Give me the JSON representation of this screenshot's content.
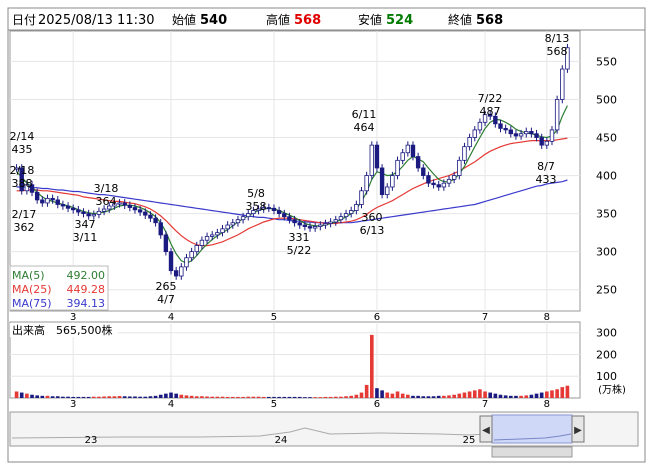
{
  "header": {
    "date_label": "日付",
    "datetime": "2025/08/13 11:30",
    "open_label": "始値",
    "open_value": "540",
    "high_label": "高値",
    "high_value": "568",
    "low_label": "安値",
    "low_value": "524",
    "close_label": "終値",
    "close_value": "568"
  },
  "colors": {
    "up": "#ffffff",
    "down": "#1a1a80",
    "ma5": "#2e7d32",
    "ma25": "#e53935",
    "ma75": "#3a3acc",
    "volume": "#1a1a80",
    "volume_spike": "#e53935",
    "high_value_color": "#e00000",
    "low_value_color": "#007a00"
  },
  "legend": {
    "ma5_label": "MA(5)",
    "ma5_value": "492.00",
    "ma25_label": "MA(25)",
    "ma25_value": "449.28",
    "ma75_label": "MA(75)",
    "ma75_value": "394.13"
  },
  "volume_panel": {
    "label": "出来高",
    "value": "565,500株",
    "unit": "(万株)",
    "ticks": [
      "300",
      "200",
      "100"
    ]
  },
  "navigator": {
    "labels": [
      "23",
      "24",
      "25"
    ]
  },
  "chart_data": {
    "type": "candlestick",
    "y_ticks": [
      "550",
      "500",
      "450",
      "400",
      "350",
      "300",
      "250"
    ],
    "ylim": [
      222,
      590
    ],
    "x_ticks": [
      "3",
      "4",
      "5",
      "6",
      "7",
      "8"
    ],
    "annotations": [
      {
        "date": "2/14",
        "value": "435"
      },
      {
        "date": "2/18",
        "value": "388"
      },
      {
        "date": "2/17",
        "value": "362"
      },
      {
        "date": "3/18",
        "value": "364"
      },
      {
        "date": "3/11",
        "value": "347"
      },
      {
        "date": "4/7",
        "value": "265"
      },
      {
        "date": "5/8",
        "value": "358"
      },
      {
        "date": "5/22",
        "value": "331"
      },
      {
        "date": "6/11",
        "value": "464"
      },
      {
        "date": "6/13",
        "value": "360"
      },
      {
        "date": "7/22",
        "value": "487"
      },
      {
        "date": "8/7",
        "value": "433"
      },
      {
        "date": "8/13",
        "value": "568"
      }
    ],
    "price_closes": [
      410,
      380,
      388,
      378,
      368,
      364,
      370,
      368,
      362,
      360,
      357,
      355,
      352,
      350,
      347,
      349,
      353,
      356,
      360,
      363,
      364,
      361,
      358,
      355,
      352,
      348,
      344,
      338,
      322,
      300,
      275,
      268,
      280,
      292,
      300,
      308,
      315,
      320,
      322,
      325,
      330,
      335,
      338,
      342,
      346,
      350,
      354,
      356,
      358,
      357,
      354,
      350,
      346,
      342,
      338,
      335,
      333,
      331,
      333,
      335,
      337,
      339,
      342,
      346,
      350,
      354,
      362,
      380,
      400,
      440,
      410,
      375,
      385,
      400,
      420,
      430,
      440,
      425,
      410,
      400,
      390,
      388,
      385,
      390,
      395,
      400,
      420,
      438,
      450,
      460,
      470,
      480,
      478,
      468,
      462,
      460,
      455,
      452,
      455,
      458,
      455,
      450,
      440,
      445,
      460,
      500,
      540,
      568
    ],
    "ma5": [
      405,
      398,
      390,
      385,
      378,
      372,
      368,
      366,
      364,
      362,
      360,
      358,
      355,
      353,
      351,
      350,
      351,
      352,
      354,
      357,
      360,
      361,
      361,
      360,
      358,
      355,
      351,
      346,
      338,
      326,
      310,
      297,
      288,
      285,
      288,
      295,
      303,
      310,
      316,
      321,
      325,
      329,
      334,
      339,
      343,
      347,
      351,
      354,
      356,
      357,
      356,
      354,
      351,
      348,
      345,
      341,
      337,
      335,
      334,
      334,
      335,
      337,
      339,
      342,
      346,
      350,
      356,
      366,
      378,
      395,
      405,
      403,
      400,
      401,
      405,
      412,
      420,
      425,
      422,
      418,
      410,
      402,
      395,
      392,
      392,
      395,
      402,
      412,
      425,
      438,
      450,
      462,
      470,
      474,
      473,
      470,
      466,
      461,
      458,
      456,
      455,
      453,
      451,
      450,
      452,
      460,
      478,
      492
    ],
    "ma25": [
      380,
      380,
      381,
      381,
      381,
      380,
      380,
      379,
      378,
      377,
      376,
      375,
      374,
      372,
      371,
      370,
      369,
      368,
      367,
      366,
      366,
      365,
      364,
      363,
      361,
      359,
      356,
      352,
      347,
      341,
      334,
      327,
      321,
      316,
      312,
      309,
      308,
      308,
      309,
      311,
      313,
      316,
      319,
      322,
      326,
      330,
      333,
      336,
      339,
      341,
      343,
      344,
      344,
      344,
      343,
      342,
      341,
      340,
      339,
      338,
      337,
      337,
      337,
      338,
      339,
      340,
      342,
      345,
      349,
      354,
      358,
      361,
      364,
      367,
      371,
      375,
      379,
      383,
      386,
      389,
      392,
      394,
      396,
      398,
      400,
      403,
      406,
      410,
      414,
      418,
      423,
      428,
      432,
      435,
      438,
      440,
      442,
      443,
      444,
      445,
      446,
      446,
      446,
      446,
      446,
      447,
      448,
      449.28
    ],
    "ma75": [
      385,
      385,
      385,
      384,
      384,
      383,
      383,
      382,
      381,
      381,
      380,
      379,
      379,
      378,
      377,
      376,
      375,
      375,
      374,
      373,
      372,
      371,
      370,
      369,
      368,
      367,
      366,
      365,
      364,
      363,
      362,
      361,
      360,
      359,
      358,
      357,
      356,
      355,
      354,
      353,
      352,
      351,
      350,
      349,
      348,
      347,
      346,
      345,
      345,
      344,
      343,
      342,
      342,
      341,
      340,
      340,
      339,
      339,
      338,
      338,
      338,
      338,
      338,
      338,
      338,
      338,
      339,
      340,
      341,
      342,
      343,
      344,
      345,
      346,
      347,
      348,
      349,
      350,
      351,
      352,
      353,
      354,
      355,
      356,
      357,
      358,
      359,
      360,
      361,
      362,
      364,
      366,
      368,
      370,
      372,
      374,
      376,
      378,
      380,
      382,
      384,
      386,
      387,
      389,
      390,
      391,
      392,
      394.13
    ],
    "volume": [
      30,
      25,
      20,
      15,
      12,
      10,
      10,
      8,
      8,
      6,
      6,
      5,
      5,
      5,
      5,
      6,
      6,
      7,
      8,
      8,
      9,
      8,
      7,
      7,
      6,
      6,
      8,
      10,
      15,
      20,
      25,
      20,
      15,
      12,
      10,
      8,
      8,
      7,
      6,
      6,
      6,
      5,
      5,
      5,
      5,
      6,
      6,
      6,
      5,
      5,
      5,
      5,
      5,
      5,
      5,
      5,
      4,
      4,
      4,
      4,
      5,
      5,
      6,
      6,
      8,
      10,
      15,
      25,
      60,
      290,
      45,
      35,
      25,
      20,
      30,
      20,
      15,
      10,
      10,
      8,
      8,
      8,
      10,
      10,
      12,
      15,
      20,
      25,
      30,
      35,
      40,
      30,
      25,
      20,
      15,
      12,
      10,
      10,
      10,
      12,
      15,
      20,
      25,
      30,
      35,
      40,
      50,
      56.55
    ]
  }
}
